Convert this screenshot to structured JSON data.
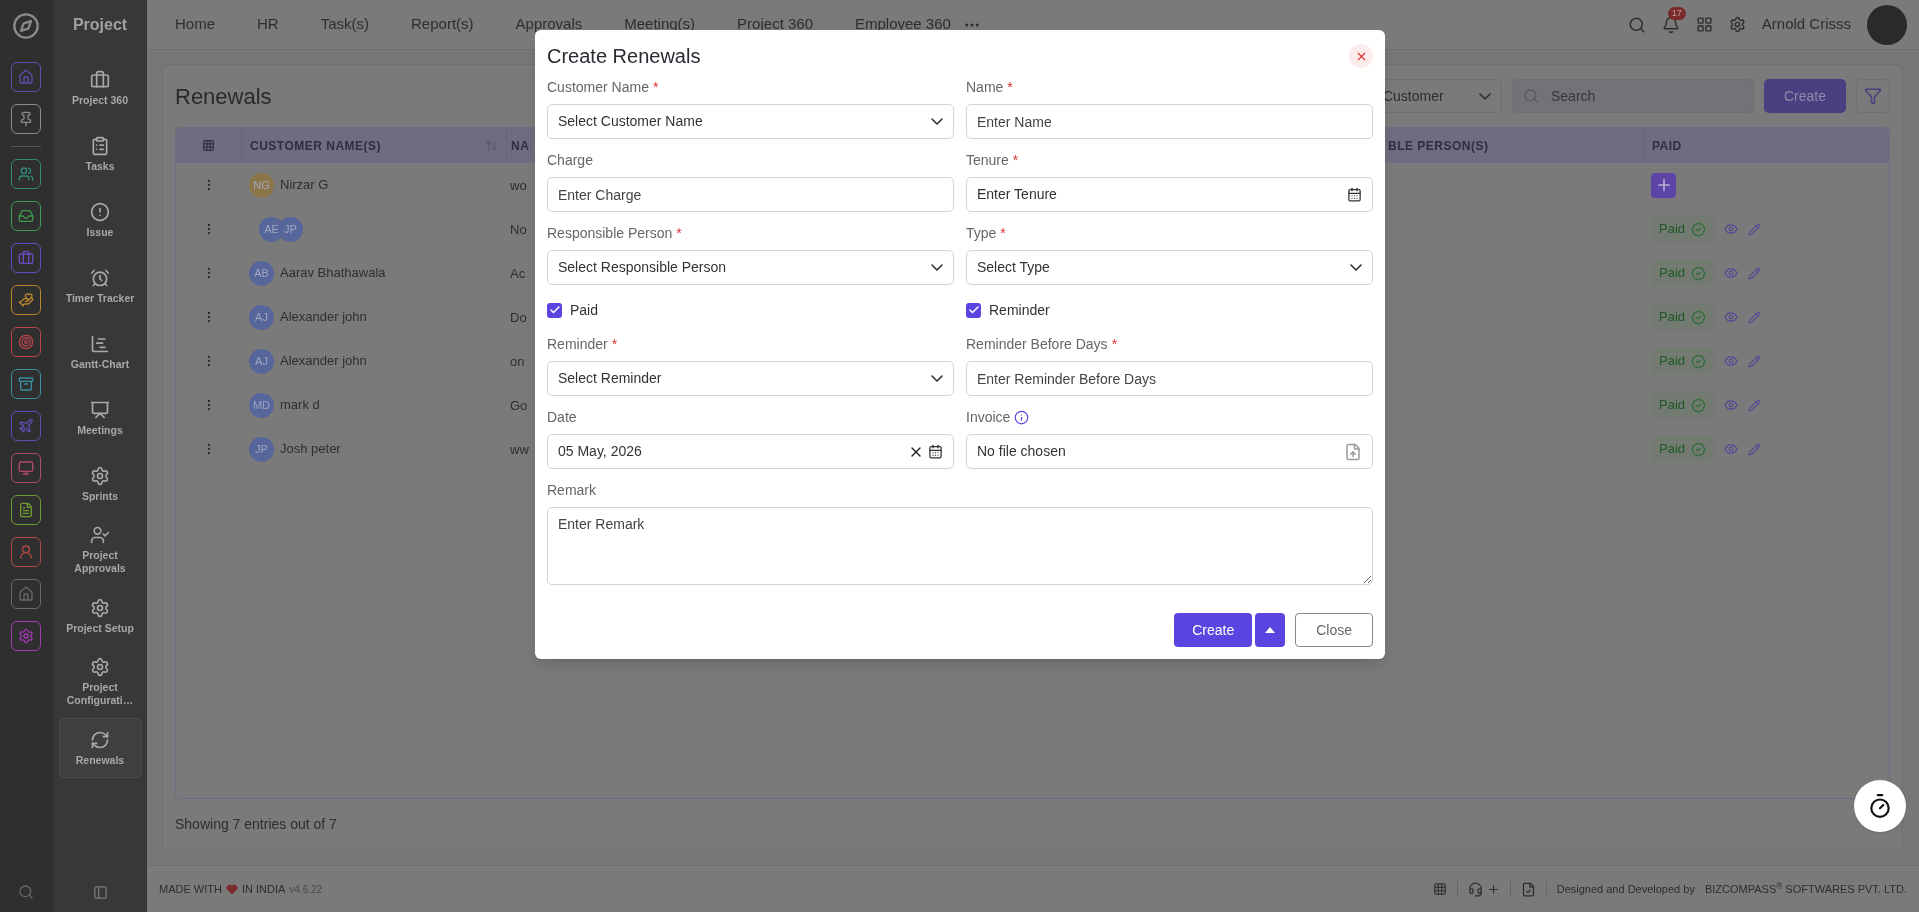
{
  "app": {
    "title": "Project"
  },
  "sidebar": {
    "items": [
      {
        "label": "Project 360",
        "selected": false
      },
      {
        "label": "Tasks",
        "selected": false
      },
      {
        "label": "Issue",
        "selected": false
      },
      {
        "label": "Timer Tracker",
        "selected": false
      },
      {
        "label": "Gantt-Chart",
        "selected": false
      },
      {
        "label": "Meetings",
        "selected": false
      },
      {
        "label": "Sprints",
        "selected": false
      },
      {
        "label": "Project Approvals",
        "selected": false
      },
      {
        "label": "Project Setup",
        "selected": false
      },
      {
        "label": "Project Configurati…",
        "selected": false
      },
      {
        "label": "Renewals",
        "selected": true
      }
    ]
  },
  "top_nav": {
    "items": [
      "Home",
      "HR",
      "Task(s)",
      "Report(s)",
      "Approvals",
      "Meeting(s)",
      "Project 360",
      "Employee 360"
    ],
    "notification_count": "17",
    "user_name": "Arnold Crisss"
  },
  "page": {
    "title": "Renewals",
    "filter_select": "Customer",
    "search": {
      "placeholder": "Search"
    },
    "create_button": "Create",
    "table": {
      "columns": [
        {
          "label": "CUSTOMER NAME(S)",
          "sortable": true
        },
        {
          "label": "NA"
        },
        {
          "label": "BLE PERSON(S)"
        },
        {
          "label": "PAID"
        }
      ],
      "rows": [
        {
          "avatars": [
            {
              "initials": "NG",
              "color": "#8c7548"
            }
          ],
          "customer": "Nirzar G",
          "column_2": "wo",
          "paid": false
        },
        {
          "avatars": [
            {
              "initials": "AE",
              "color": "#56659a"
            },
            {
              "initials": "JP",
              "color": "#56659a"
            }
          ],
          "column_2": "No",
          "paid": true,
          "paid_label": "Paid"
        },
        {
          "avatars": [
            {
              "initials": "AB",
              "color": "#56659a"
            }
          ],
          "customer": "Aarav Bhathawala",
          "column_2": "Ac",
          "paid": true,
          "paid_label": "Paid"
        },
        {
          "avatars": [
            {
              "initials": "AJ",
              "color": "#56659a"
            }
          ],
          "customer": "Alexander john",
          "column_2": "Do",
          "paid": true,
          "paid_label": "Paid"
        },
        {
          "avatars": [
            {
              "initials": "AJ",
              "color": "#56659a"
            }
          ],
          "customer": "Alexander john",
          "column_2": "on",
          "paid": true,
          "paid_label": "Paid"
        },
        {
          "avatars": [
            {
              "initials": "MD",
              "color": "#56659a"
            }
          ],
          "customer": "mark d",
          "column_2": "Go",
          "paid": true,
          "paid_label": "Paid"
        },
        {
          "avatars": [
            {
              "initials": "JP",
              "color": "#56659a"
            }
          ],
          "customer": "Josh peter",
          "column_2": "ww",
          "paid": true,
          "paid_label": "Paid"
        }
      ]
    },
    "entries_text": "Showing 7 entries out of 7"
  },
  "footer": {
    "made_with": "MADE WITH",
    "in_india": "IN INDIA",
    "version": "v4.6.22",
    "credit": "Designed and Developed by",
    "company": "BIZCOMPASS$^{®}$ SOFTWARES PVT. LTD."
  },
  "modal": {
    "title": "Create Renewals",
    "fields": [
      {
        "kind": "select",
        "label": "Customer Name",
        "required_mark": "*",
        "placeholder": "Select Customer Name"
      },
      {
        "kind": "input",
        "label": "Name",
        "required_mark": "*",
        "placeholder": "Enter Name"
      },
      {
        "kind": "input",
        "label": "Charge",
        "placeholder": "Enter Charge"
      },
      {
        "kind": "date",
        "label": "Tenure",
        "required_mark": "*",
        "placeholder": "Enter Tenure"
      },
      {
        "kind": "select",
        "label": "Responsible Person",
        "required_mark": "*",
        "placeholder": "Select Responsible Person"
      },
      {
        "kind": "select",
        "label": "Type",
        "required_mark": "*",
        "placeholder": "Select Type"
      },
      {
        "kind": "checkbox",
        "label": "Paid",
        "checked": true
      },
      {
        "kind": "checkbox",
        "label": "Reminder",
        "checked": true
      },
      {
        "kind": "select",
        "label": "Reminder",
        "required_mark": "*",
        "placeholder": "Select Reminder"
      },
      {
        "kind": "input",
        "label": "Reminder Before Days",
        "required_mark": "*",
        "placeholder": "Enter Reminder Before Days"
      },
      {
        "kind": "date",
        "label": "Date",
        "value": "05 May, 2026",
        "clearable": true
      },
      {
        "kind": "file",
        "label": "Invoice",
        "info": true,
        "status": "No file chosen"
      },
      {
        "kind": "textarea",
        "label": "Remark",
        "placeholder": "Enter Remark"
      }
    ],
    "create_button": "Create",
    "close_button": "Close"
  }
}
